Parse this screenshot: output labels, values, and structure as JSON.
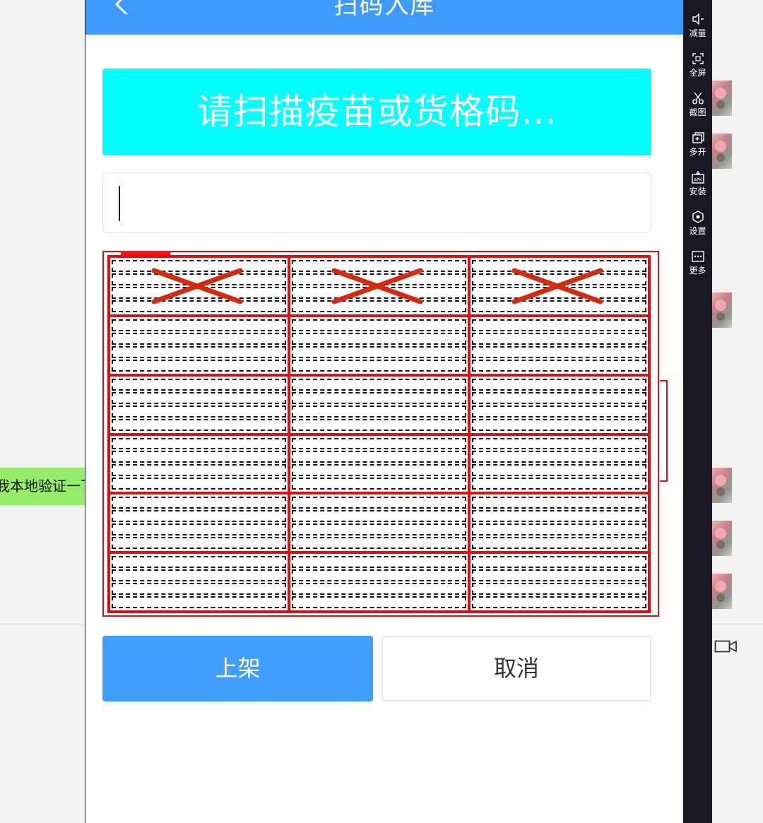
{
  "app": {
    "title": "扫码入库"
  },
  "scan_prompt": "请扫描疫苗或货格码...",
  "scan_input": {
    "value": ""
  },
  "rack": {
    "columns": 3,
    "rows": 6,
    "tubes_per_slot": 4,
    "crossed_slots": [
      0,
      1,
      2
    ],
    "accent_color": "#e01010"
  },
  "actions": {
    "confirm_label": "上架",
    "cancel_label": "取消"
  },
  "toolbar": {
    "items": [
      {
        "label": "减量",
        "icon": "volume-down-icon"
      },
      {
        "label": "全屏",
        "icon": "fullscreen-icon"
      },
      {
        "label": "截图",
        "icon": "scissors-icon"
      },
      {
        "label": "多开",
        "icon": "multi-instance-icon"
      },
      {
        "label": "安装",
        "icon": "apk-install-icon"
      },
      {
        "label": "设置",
        "icon": "settings-icon"
      },
      {
        "label": "更多",
        "icon": "more-icon"
      }
    ]
  },
  "background_chat": {
    "bubble_text": "我本地验证一下"
  },
  "colors": {
    "appbar": "#3d9bff",
    "scan_banner": "#00ffff",
    "primary_button": "#409eff",
    "toolbar": "#171821"
  }
}
